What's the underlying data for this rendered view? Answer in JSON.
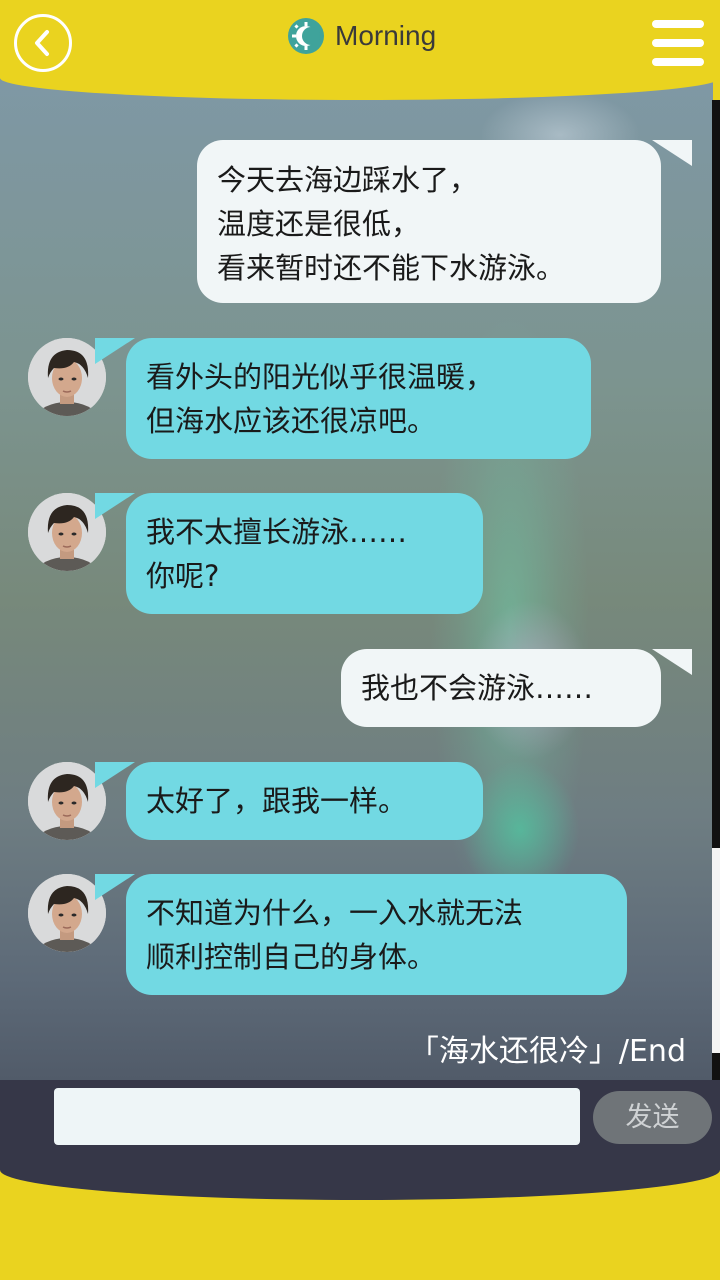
{
  "header": {
    "title": "Morning",
    "back_icon": "back-chevron-icon",
    "title_icon": "morning-sun-icon",
    "menu_icon": "hamburger-menu-icon"
  },
  "messages": [
    {
      "sender": "me",
      "text": "今天去海边踩水了，\n温度还是很低，\n看来暂时还不能下水游泳。"
    },
    {
      "sender": "them",
      "text": "看外头的阳光似乎很温暖，\n但海水应该还很凉吧。"
    },
    {
      "sender": "them",
      "text": "我不太擅长游泳……\n你呢?"
    },
    {
      "sender": "me",
      "text": "我也不会游泳……"
    },
    {
      "sender": "them",
      "text": "太好了，跟我一样。"
    },
    {
      "sender": "them",
      "text": "不知道为什么，一入水就无法\n顺利控制自己的身体。"
    }
  ],
  "end_label": "「海水还很冷」/End",
  "input": {
    "value": "",
    "placeholder": ""
  },
  "send_label": "发送",
  "colors": {
    "header": "#ead31f",
    "bubble_me": "#f1f6f7",
    "bubble_them": "#72d9e3",
    "input_bar": "#363748"
  }
}
